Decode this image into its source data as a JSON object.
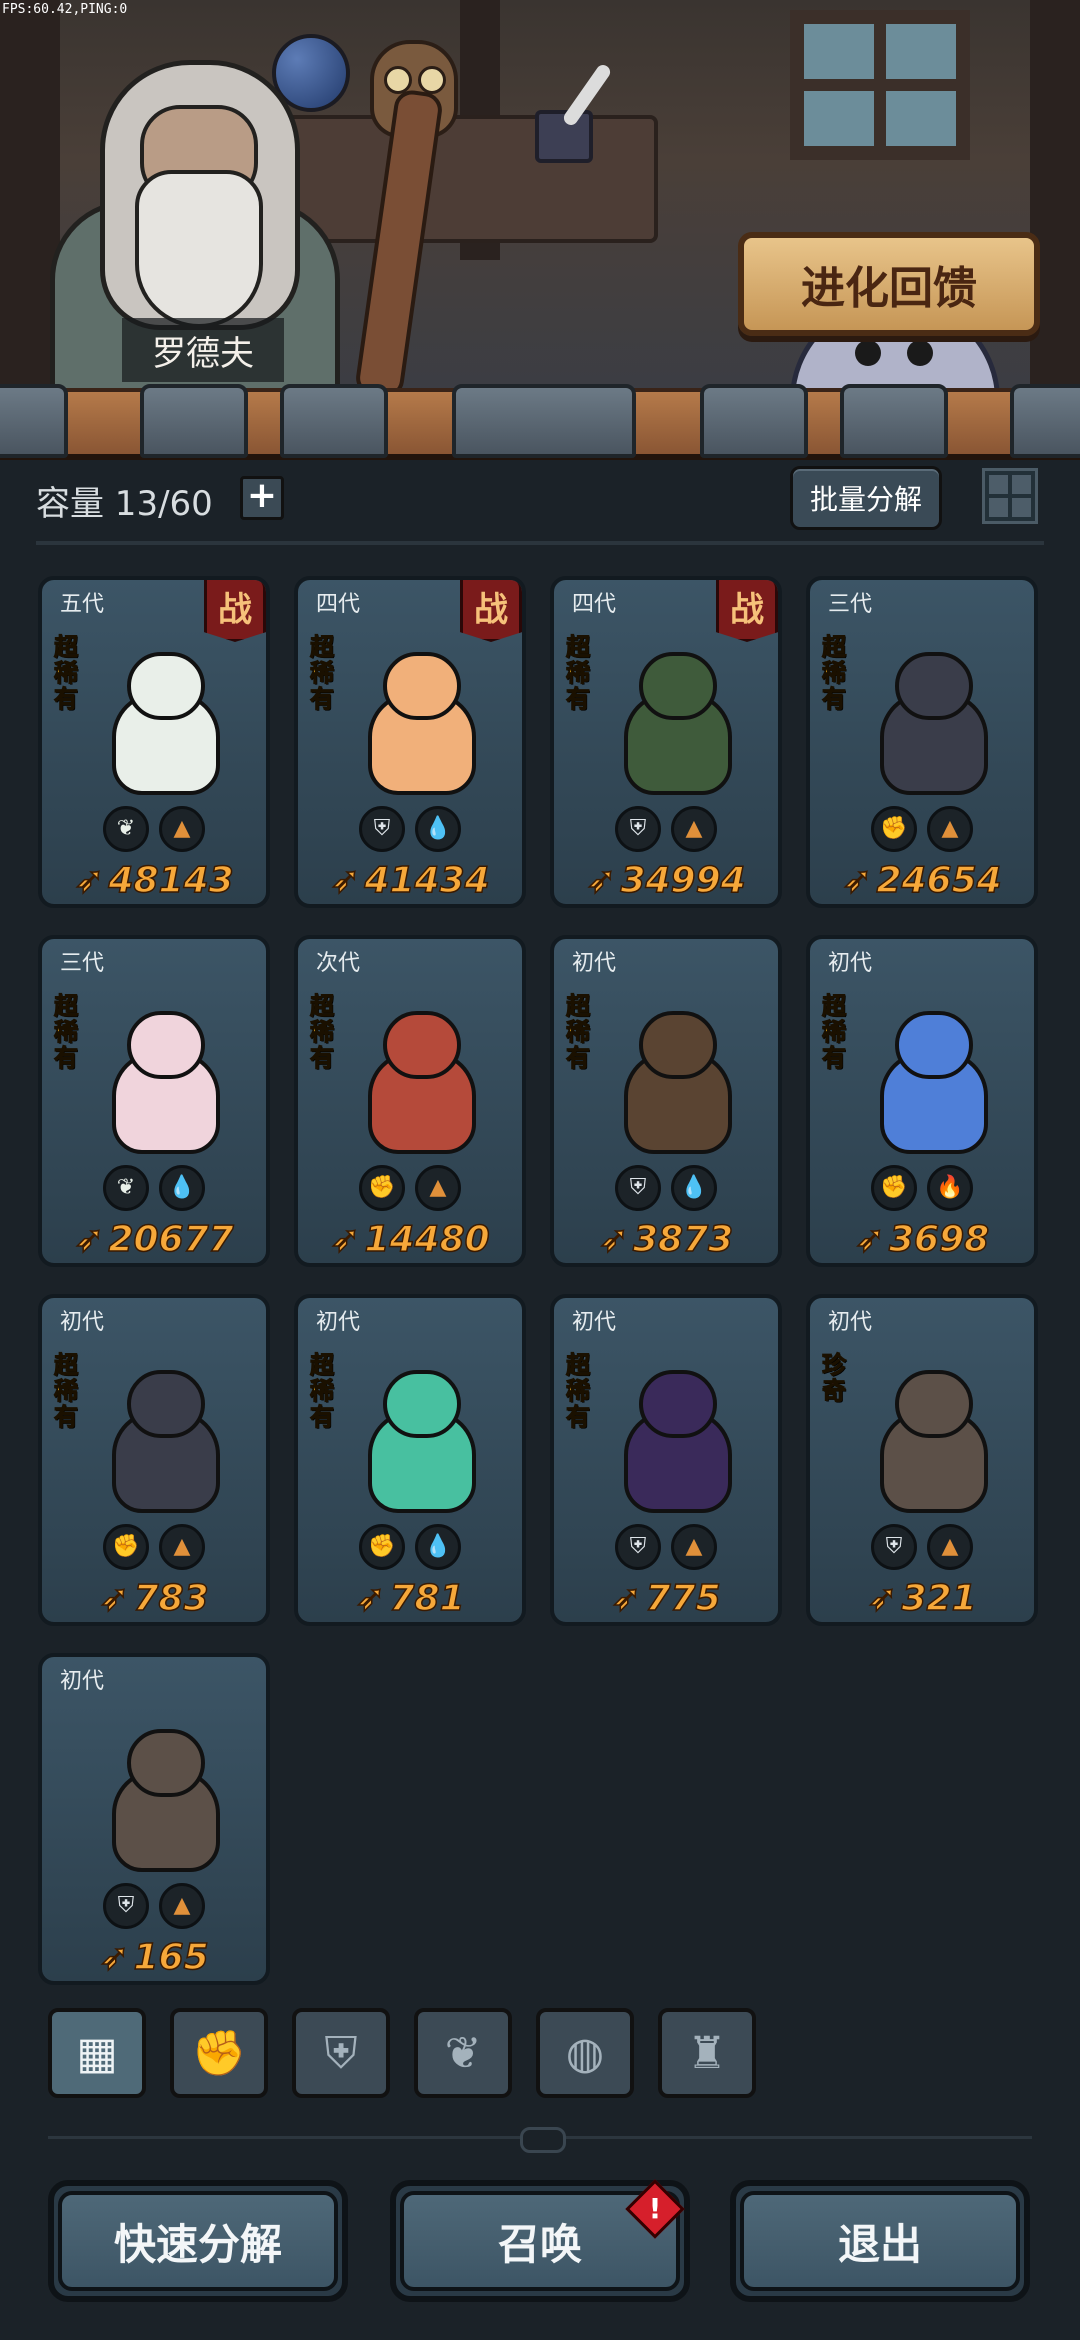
{
  "debug": {
    "fps_text": "FPS:60.42,PING:0"
  },
  "scene": {
    "npc_name": "罗德夫",
    "evolution_button": "进化回馈"
  },
  "capacity": {
    "label": "容量 13/60",
    "plus": "+"
  },
  "toolbar": {
    "batch_decompose": "批量分解"
  },
  "cards": [
    {
      "gen": "五代",
      "rarity": "超稀有",
      "rarity_type": "super",
      "battle": "战",
      "element1": "leaf",
      "element2": "earth",
      "power": "48143",
      "color": "#e9efe9"
    },
    {
      "gen": "四代",
      "rarity": "超稀有",
      "rarity_type": "super",
      "battle": "战",
      "element1": "shield",
      "element2": "water",
      "power": "41434",
      "color": "#f1b07a"
    },
    {
      "gen": "四代",
      "rarity": "超稀有",
      "rarity_type": "super",
      "battle": "战",
      "element1": "shield",
      "element2": "earth",
      "power": "34994",
      "color": "#3f5b3b"
    },
    {
      "gen": "三代",
      "rarity": "超稀有",
      "rarity_type": "super",
      "battle": "",
      "element1": "fist",
      "element2": "earth",
      "power": "24654",
      "color": "#3a3d4a"
    },
    {
      "gen": "三代",
      "rarity": "超稀有",
      "rarity_type": "super",
      "battle": "",
      "element1": "leaf",
      "element2": "water",
      "power": "20677",
      "color": "#f0d4dc"
    },
    {
      "gen": "次代",
      "rarity": "超稀有",
      "rarity_type": "super",
      "battle": "",
      "element1": "fist",
      "element2": "earth",
      "power": "14480",
      "color": "#b54a3a"
    },
    {
      "gen": "初代",
      "rarity": "超稀有",
      "rarity_type": "super",
      "battle": "",
      "element1": "shield",
      "element2": "water",
      "power": "3873",
      "color": "#5a4432"
    },
    {
      "gen": "初代",
      "rarity": "超稀有",
      "rarity_type": "super",
      "battle": "",
      "element1": "fist",
      "element2": "fire",
      "power": "3698",
      "color": "#4f7fd8"
    },
    {
      "gen": "初代",
      "rarity": "超稀有",
      "rarity_type": "super",
      "battle": "",
      "element1": "fist",
      "element2": "earth",
      "power": "783",
      "color": "#3a3d4a"
    },
    {
      "gen": "初代",
      "rarity": "超稀有",
      "rarity_type": "super",
      "battle": "",
      "element1": "fist",
      "element2": "water",
      "power": "781",
      "color": "#48c0a0"
    },
    {
      "gen": "初代",
      "rarity": "超稀有",
      "rarity_type": "super",
      "battle": "",
      "element1": "shield",
      "element2": "earth",
      "power": "775",
      "color": "#3a2a5a"
    },
    {
      "gen": "初代",
      "rarity": "珍奇",
      "rarity_type": "rare",
      "battle": "",
      "element1": "shield",
      "element2": "earth",
      "power": "321",
      "color": "#5c5048"
    },
    {
      "gen": "初代",
      "rarity": "",
      "rarity_type": "none",
      "battle": "",
      "element1": "shield",
      "element2": "earth",
      "power": "165",
      "color": "#5c5048"
    }
  ],
  "filter_tabs": [
    {
      "icon": "all-blocks-icon",
      "glyph": "▦",
      "active": true
    },
    {
      "icon": "fist-icon",
      "glyph": "✊",
      "active": false
    },
    {
      "icon": "shield-icon",
      "glyph": "⛨",
      "active": false
    },
    {
      "icon": "leaf-icon",
      "glyph": "❦",
      "active": false
    },
    {
      "icon": "egg-icon",
      "glyph": "◍",
      "active": false
    },
    {
      "icon": "tower-icon",
      "glyph": "♜",
      "active": false
    }
  ],
  "bottom_buttons": {
    "quick_decompose": "快速分解",
    "summon": "召唤",
    "exit": "退出",
    "summon_alert": "!"
  }
}
